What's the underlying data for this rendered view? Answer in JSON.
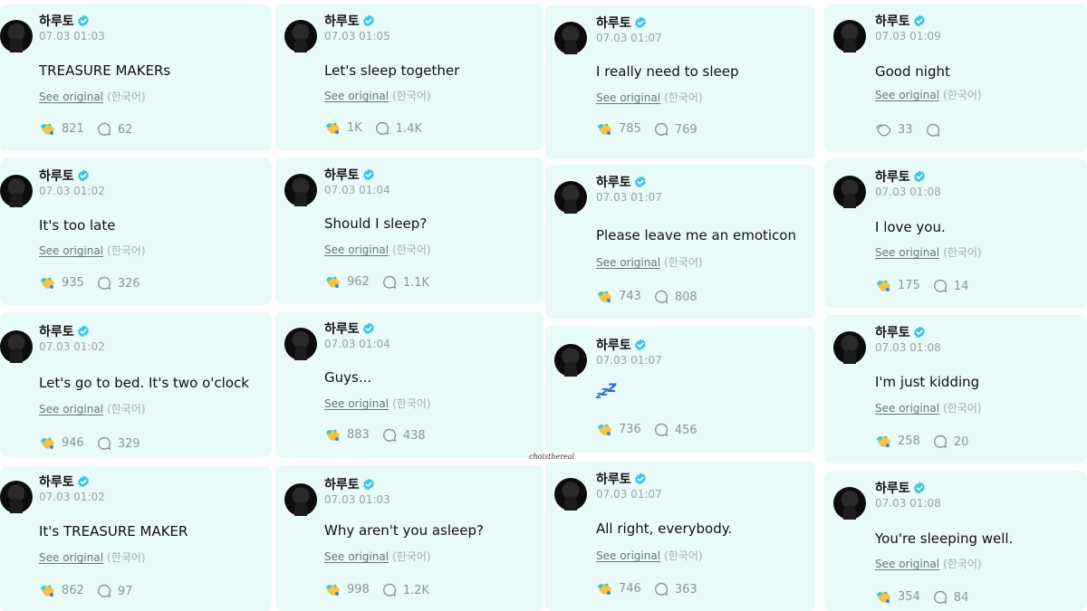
{
  "colors": {
    "card_bg": "#e8fbf8",
    "verified": "#3bc6e0",
    "text_muted": "#9aa3a2"
  },
  "icons": {
    "verified": "verified-badge-icon",
    "reaction": "wave-hand-reaction-icon",
    "comment": "comment-bubble-icon"
  },
  "watermark": "choisthereal",
  "columns": [
    {
      "cards": [
        {
          "author": "하루토",
          "time": "07.03 01:03",
          "text": "TREASURE MAKERs",
          "see_original": "See original",
          "lang": "(한국어)",
          "reactions": "821",
          "comments": "62"
        },
        {
          "author": "하루토",
          "time": "07.03 01:02",
          "text": "It's too late",
          "see_original": "See original",
          "lang": "(한국어)",
          "reactions": "935",
          "comments": "326"
        },
        {
          "author": "하루토",
          "time": "07.03 01:02",
          "text": "Let's go to bed. It's two o'clock",
          "see_original": "See original",
          "lang": "(한국어)",
          "reactions": "946",
          "comments": "329"
        },
        {
          "author": "하루토",
          "time": "07.03 01:02",
          "text": "It's TREASURE MAKER",
          "see_original": "See original",
          "lang": "(한국어)",
          "reactions": "862",
          "comments": "97"
        }
      ]
    },
    {
      "cards": [
        {
          "author": "하루토",
          "time": "07.03 01:05",
          "text": "Let's sleep together",
          "see_original": "See original",
          "lang": "(한국어)",
          "reactions": "1K",
          "comments": "1.4K"
        },
        {
          "author": "하루토",
          "time": "07.03 01:04",
          "text": "Should I sleep?",
          "see_original": "See original",
          "lang": "(한국어)",
          "reactions": "962",
          "comments": "1.1K"
        },
        {
          "author": "하루토",
          "time": "07.03 01:04",
          "text": "Guys...",
          "see_original": "See original",
          "lang": "(한국어)",
          "reactions": "883",
          "comments": "438"
        },
        {
          "author": "하루토",
          "time": "07.03 01:03",
          "text": "Why aren't you asleep?",
          "see_original": "See original",
          "lang": "(한국어)",
          "reactions": "998",
          "comments": "1.2K"
        }
      ]
    },
    {
      "cards": [
        {
          "author": "하루토",
          "time": "07.03 01:07",
          "text": "I really need to sleep",
          "see_original": "See original",
          "lang": "(한국어)",
          "reactions": "785",
          "comments": "769"
        },
        {
          "author": "하루토",
          "time": "07.03 01:07",
          "text": "Please leave me an emoticon",
          "see_original": "See original",
          "lang": "(한국어)",
          "reactions": "743",
          "comments": "808"
        },
        {
          "author": "하루토",
          "time": "07.03 01:07",
          "text": "zzz",
          "see_original": "",
          "lang": "",
          "reactions": "736",
          "comments": "456"
        },
        {
          "author": "하루토",
          "time": "07.03 01:07",
          "text": "All right, everybody.",
          "see_original": "See original",
          "lang": "(한국어)",
          "reactions": "746",
          "comments": "363"
        }
      ]
    },
    {
      "cards": [
        {
          "author": "하루토",
          "time": "07.03 01:09",
          "text": "Good night",
          "see_original": "See original",
          "lang": "(한국어)",
          "reactions": "33",
          "comments": ""
        },
        {
          "author": "하루토",
          "time": "07.03 01:08",
          "text": "I love you.",
          "see_original": "See original",
          "lang": "(한국어)",
          "reactions": "175",
          "comments": "14"
        },
        {
          "author": "하루토",
          "time": "07.03 01:08",
          "text": "I'm just kidding",
          "see_original": "See original",
          "lang": "(한국어)",
          "reactions": "258",
          "comments": "20"
        },
        {
          "author": "하루토",
          "time": "07.03 01:08",
          "text": "You're sleeping well.",
          "see_original": "See original",
          "lang": "(한국어)",
          "reactions": "354",
          "comments": "84"
        }
      ]
    }
  ]
}
